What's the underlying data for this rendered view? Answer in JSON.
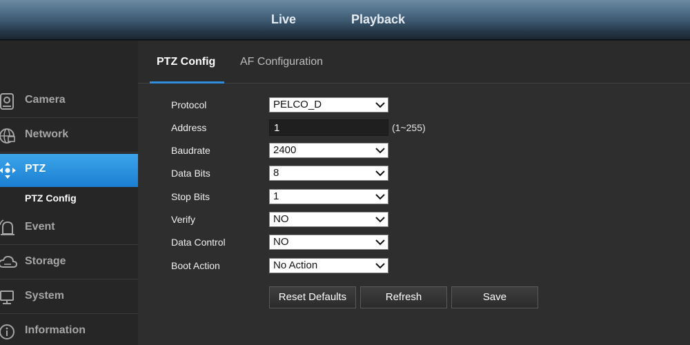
{
  "topnav": {
    "live": "Live",
    "playback": "Playback"
  },
  "sidebar": {
    "items": [
      {
        "label": "Camera",
        "icon": "camera-icon"
      },
      {
        "label": "Network",
        "icon": "network-globe-icon"
      },
      {
        "label": "PTZ",
        "icon": "ptz-arrows-icon",
        "active": true
      },
      {
        "label": "Event",
        "icon": "alarm-bell-icon"
      },
      {
        "label": "Storage",
        "icon": "cloud-storage-icon"
      },
      {
        "label": "System",
        "icon": "monitor-icon"
      },
      {
        "label": "Information",
        "icon": "info-icon"
      }
    ],
    "sub_item": "PTZ Config"
  },
  "tabs": [
    {
      "label": "PTZ Config",
      "active": true
    },
    {
      "label": "AF Configuration",
      "active": false
    }
  ],
  "form": {
    "protocol": {
      "label": "Protocol",
      "value": "PELCO_D"
    },
    "address": {
      "label": "Address",
      "value": "1",
      "hint": "(1~255)"
    },
    "baudrate": {
      "label": "Baudrate",
      "value": "2400"
    },
    "data_bits": {
      "label": "Data Bits",
      "value": "8"
    },
    "stop_bits": {
      "label": "Stop Bits",
      "value": "1"
    },
    "verify": {
      "label": "Verify",
      "value": "NO"
    },
    "data_control": {
      "label": "Data Control",
      "value": "NO"
    },
    "boot_action": {
      "label": "Boot Action",
      "value": "No Action"
    }
  },
  "buttons": {
    "reset": "Reset Defaults",
    "refresh": "Refresh",
    "save": "Save"
  },
  "colors": {
    "accent": "#1f86d8",
    "active_tab_underline": "#2f8fdd",
    "sidebar_bg": "#262626",
    "main_bg": "#2e2e2e"
  }
}
